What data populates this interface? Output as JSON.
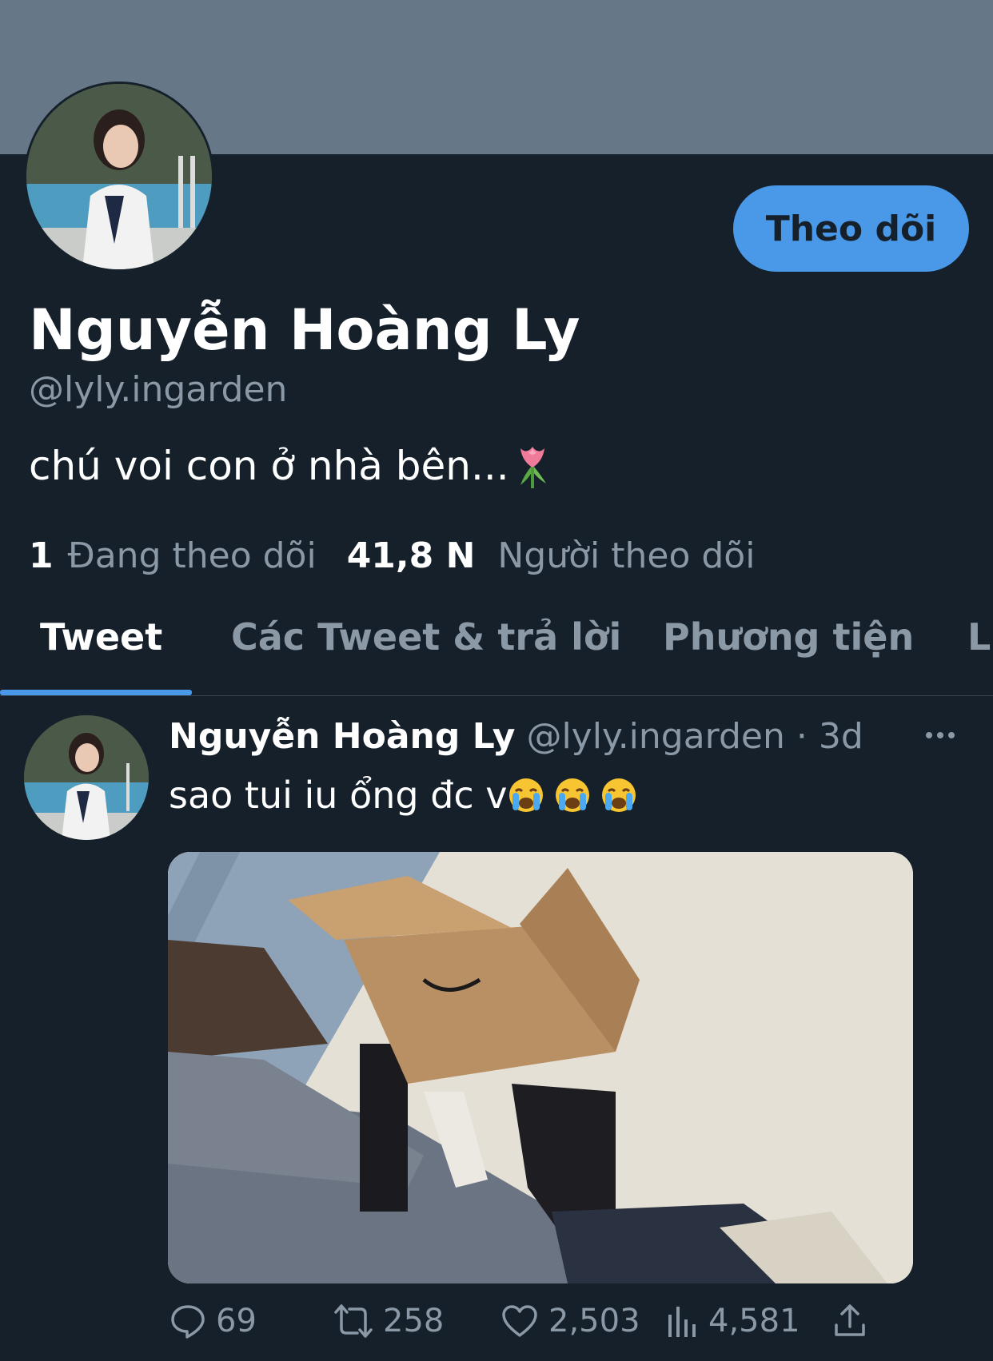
{
  "profile": {
    "display_name": "Nguyễn Hoàng Ly",
    "handle": "@lyly.ingarden",
    "bio": "chú voi con ở nhà bên...",
    "follow_button": "Theo dõi",
    "following_count": "1",
    "following_label": "Đang theo dõi",
    "followers_count": "41,8 N",
    "followers_label": "Người theo dõi"
  },
  "tabs": [
    {
      "label": "Tweet",
      "active": true
    },
    {
      "label": "Các Tweet & trả lời",
      "active": false
    },
    {
      "label": "Phương tiện",
      "active": false
    },
    {
      "label": "L",
      "active": false
    }
  ],
  "tweet": {
    "author": "Nguyễn Hoàng Ly",
    "handle": "@lyly.ingarden",
    "time": "· 3d",
    "text": "sao tui iu ổng đc v",
    "emoji": "loudly-crying-face",
    "reply_count": "69",
    "retweet_count": "258",
    "like_count": "2,503",
    "view_count": "4,581"
  },
  "colors": {
    "background": "#15202b",
    "banner": "#667787",
    "accent": "#4a99e9",
    "secondary_text": "#8b98a5"
  }
}
